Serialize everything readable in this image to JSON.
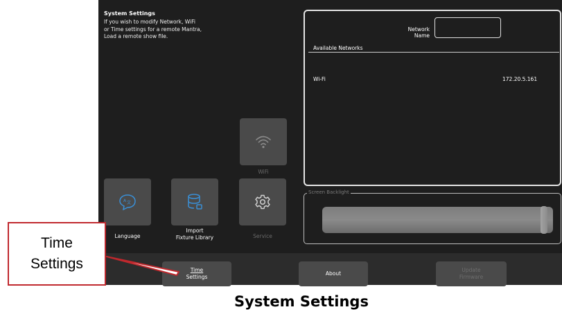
{
  "info": {
    "title": "System Settings",
    "line1": "If you wish to modify Network, WiFi",
    "line2": "or Time settings for a remote Mantra,",
    "line3": "Load a remote show file."
  },
  "network": {
    "name_label": "Network Name",
    "name_value": "",
    "available_label": "Available Networks",
    "rows": [
      {
        "name": "Wi-Fi",
        "address": "172.20.5.161"
      }
    ]
  },
  "tiles": {
    "wifi": {
      "label": "WiFi",
      "icon": "wifi-icon",
      "enabled": false
    },
    "language": {
      "label": "Language",
      "icon": "language-icon"
    },
    "import_line1": "Import",
    "import_line2": "Fixture Library",
    "import_icon": "database-icon",
    "service": {
      "label": "Service",
      "icon": "gear-icon",
      "enabled": false
    }
  },
  "backlight": {
    "label": "Screen Backlight",
    "level": 1.0
  },
  "bottom": {
    "time_line1": "Time",
    "time_line2": "Settings",
    "about": "About",
    "update_line1": "Update",
    "update_line2": "Firmware"
  },
  "callout": {
    "line1": "Time",
    "line2": "Settings",
    "border_color": "#c0282d"
  },
  "caption": "System Settings",
  "colors": {
    "accent_icon": "#3a8fd6",
    "background": "#1e1e1e",
    "tile": "#4a4a4a"
  }
}
